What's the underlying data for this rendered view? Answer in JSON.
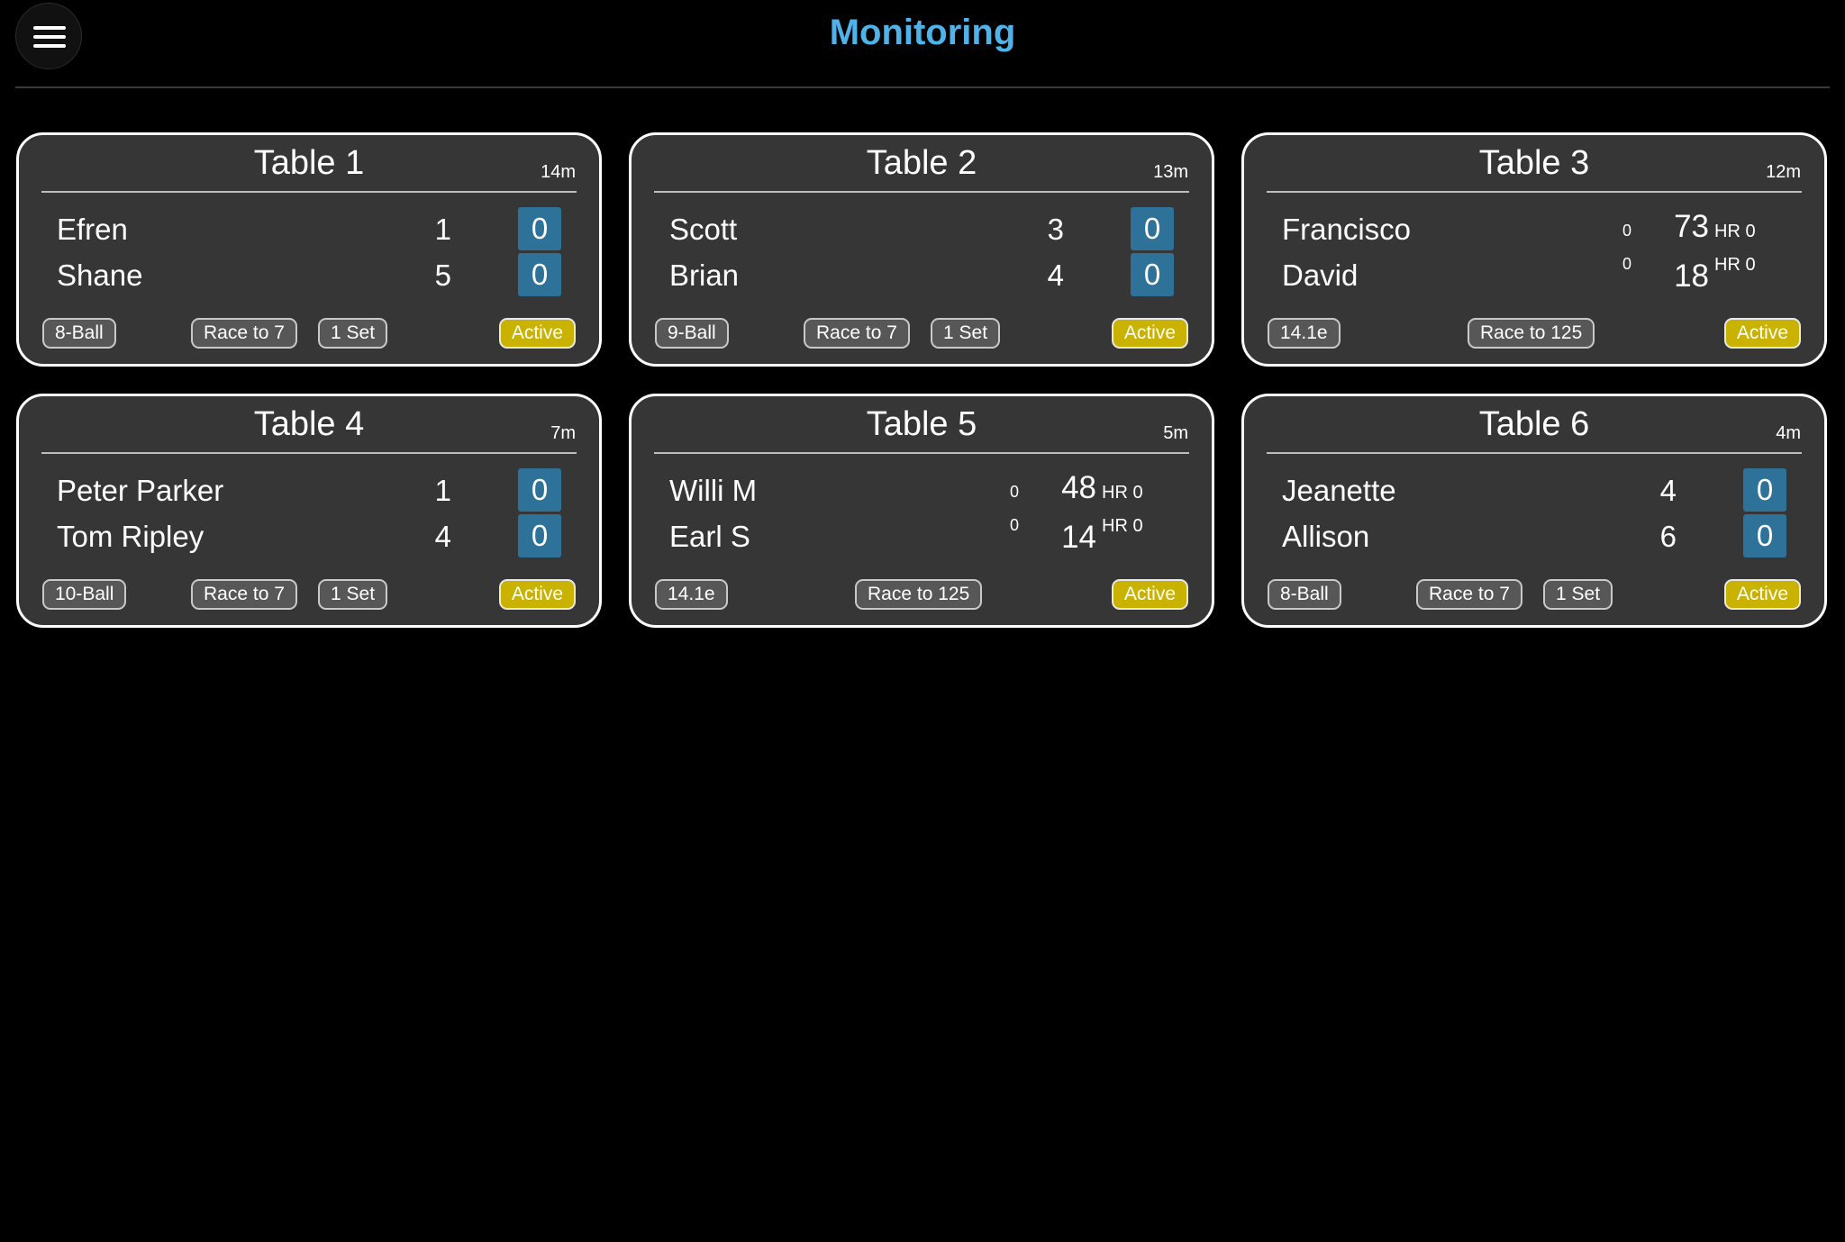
{
  "header": {
    "title": "Monitoring"
  },
  "colors": {
    "accent": "#4fb3ea",
    "games_box": "#2e7199",
    "active": "#c9b200",
    "card_bg": "#363636"
  },
  "tables": [
    {
      "name": "Table 1",
      "elapsed": "14m",
      "players": [
        {
          "name": "Efren",
          "score": "1",
          "games": "0"
        },
        {
          "name": "Shane",
          "score": "5",
          "games": "0"
        }
      ],
      "game_type": "8-Ball",
      "race": "Race to 7",
      "sets": "1 Set",
      "status": "Active"
    },
    {
      "name": "Table 2",
      "elapsed": "13m",
      "players": [
        {
          "name": "Scott",
          "score": "3",
          "games": "0"
        },
        {
          "name": "Brian",
          "score": "4",
          "games": "0"
        }
      ],
      "game_type": "9-Ball",
      "race": "Race to 7",
      "sets": "1 Set",
      "status": "Active"
    },
    {
      "name": "Table 3",
      "elapsed": "12m",
      "players": [
        {
          "name": "Francisco",
          "innings": "0",
          "score": "73",
          "hr": "HR 0"
        },
        {
          "name": "David",
          "innings": "0",
          "score": "18",
          "hr": "HR 0"
        }
      ],
      "game_type": "14.1e",
      "race": "Race to 125",
      "status": "Active"
    },
    {
      "name": "Table 4",
      "elapsed": "7m",
      "players": [
        {
          "name": "Peter Parker",
          "score": "1",
          "games": "0"
        },
        {
          "name": "Tom Ripley",
          "score": "4",
          "games": "0"
        }
      ],
      "game_type": "10-Ball",
      "race": "Race to 7",
      "sets": "1 Set",
      "status": "Active"
    },
    {
      "name": "Table 5",
      "elapsed": "5m",
      "players": [
        {
          "name": "Willi M",
          "innings": "0",
          "score": "48",
          "hr": "HR 0"
        },
        {
          "name": "Earl S",
          "innings": "0",
          "score": "14",
          "hr": "HR 0"
        }
      ],
      "game_type": "14.1e",
      "race": "Race to 125",
      "status": "Active"
    },
    {
      "name": "Table 6",
      "elapsed": "4m",
      "players": [
        {
          "name": "Jeanette",
          "score": "4",
          "games": "0"
        },
        {
          "name": "Allison",
          "score": "6",
          "games": "0"
        }
      ],
      "game_type": "8-Ball",
      "race": "Race to 7",
      "sets": "1 Set",
      "status": "Active"
    }
  ]
}
